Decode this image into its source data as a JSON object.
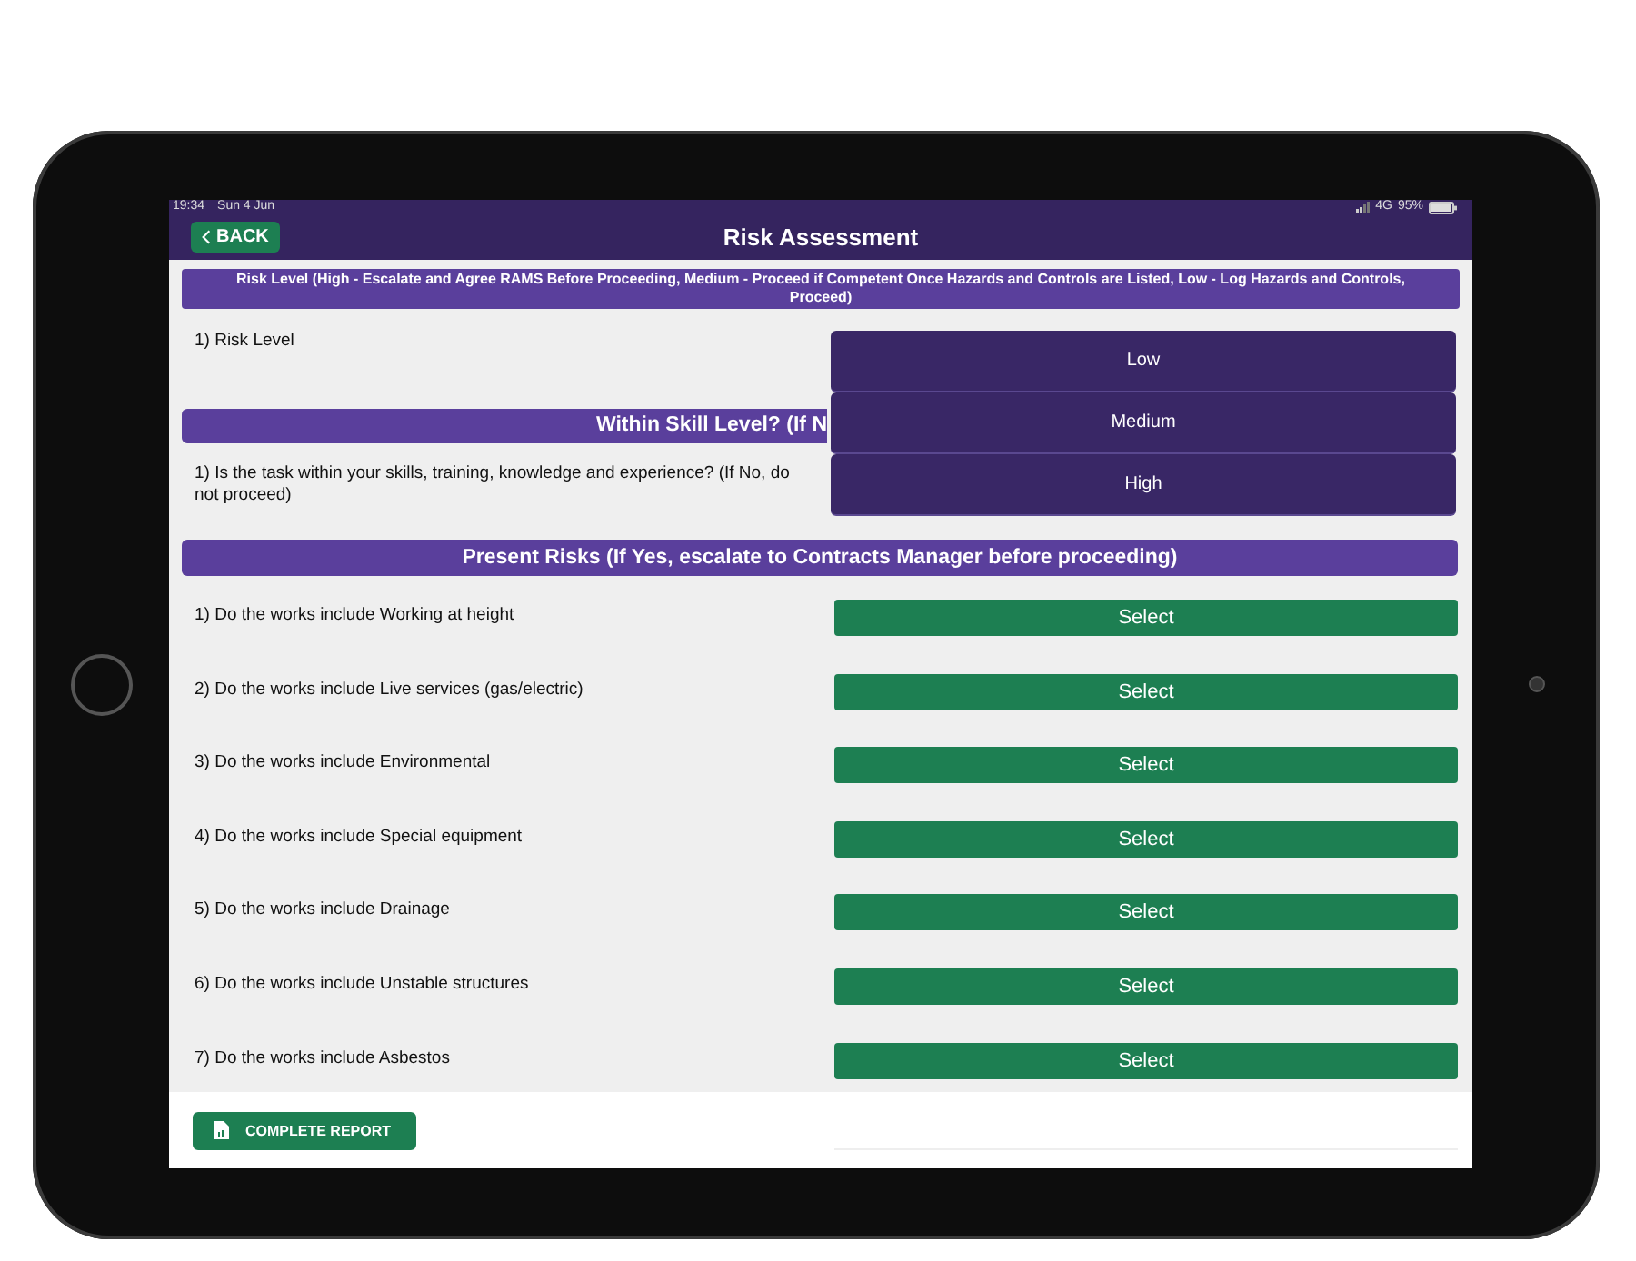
{
  "status_bar": {
    "time": "19:34",
    "date": "Sun 4 Jun",
    "network": "4G",
    "battery": "95%"
  },
  "header": {
    "back": "BACK",
    "title": "Risk Assessment"
  },
  "banner": "Risk Level (High - Escalate and Agree RAMS Before Proceeding, Medium - Proceed if Competent Once Hazards and Controls are Listed, Low - Log Hazards and Controls, Proceed)",
  "risk_level": {
    "label": "1) Risk Level"
  },
  "skill_section": {
    "heading": "Within Skill Level? (If N",
    "question": "1) Is the task within your skills, training, knowledge and experience? (If No, do not proceed)"
  },
  "dropdown": {
    "options": [
      "Low",
      "Medium",
      "High"
    ]
  },
  "risks_section": {
    "heading": "Present Risks (If Yes, escalate to Contracts Manager before proceeding)",
    "questions": [
      {
        "label": "1) Do the works include Working at height",
        "button": "Select"
      },
      {
        "label": "2) Do the works include Live services (gas/electric)",
        "button": "Select"
      },
      {
        "label": "3) Do the works include Environmental",
        "button": "Select"
      },
      {
        "label": "4) Do the works include Special equipment",
        "button": "Select"
      },
      {
        "label": "5) Do the works include Drainage",
        "button": "Select"
      },
      {
        "label": "6) Do the works include Unstable structures",
        "button": "Select"
      },
      {
        "label": "7) Do the works include Asbestos",
        "button": "Select"
      }
    ]
  },
  "footer": {
    "button": "COMPLETE REPORT"
  }
}
